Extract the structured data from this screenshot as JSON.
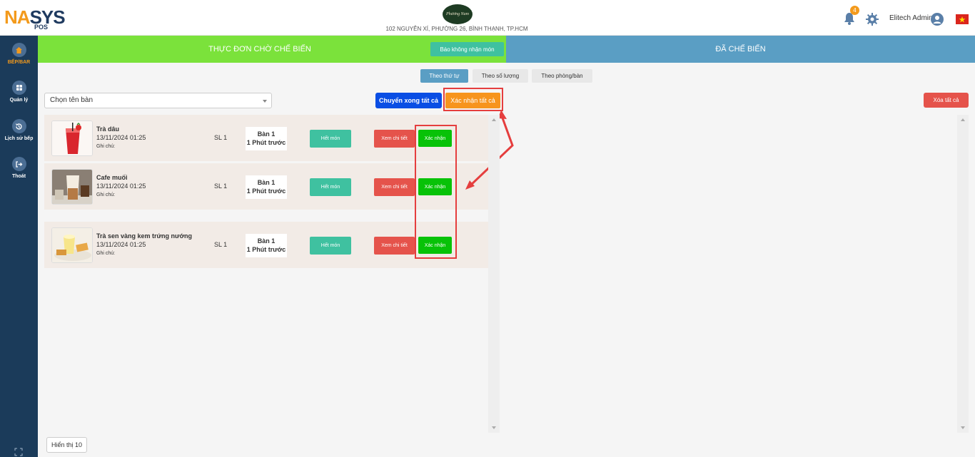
{
  "header": {
    "logo_na": "NA",
    "logo_sys": "SYS",
    "logo_pos": "POS",
    "store_logo_text": "Phương Nam",
    "store_address": "102 NGUYỄN XÍ, PHƯỜNG 26, BÌNH THẠNH, TP.HCM",
    "notification_count": "4",
    "user_name": "Elitech Admin"
  },
  "sidebar": {
    "items": [
      {
        "label": "BẾP/BAR",
        "icon": "home-icon"
      },
      {
        "label": "Quản lý",
        "icon": "grid-icon"
      },
      {
        "label": "Lịch sử bếp",
        "icon": "history-icon"
      },
      {
        "label": "Thoát",
        "icon": "logout-icon"
      }
    ]
  },
  "left_pane": {
    "title": "THỰC ĐƠN CHỜ CHẾ BIẾN",
    "report_button": "Báo không nhận món"
  },
  "right_pane": {
    "title": "ĐÃ CHẾ BIẾN",
    "clear_all_button": "Xóa tất cả"
  },
  "tabs": [
    {
      "label": "Theo thứ tự",
      "active": true
    },
    {
      "label": "Theo số lượng",
      "active": false
    },
    {
      "label": "Theo phòng/bàn",
      "active": false
    }
  ],
  "toolbar": {
    "table_select_placeholder": "Chọn tên bàn",
    "finish_all_button": "Chuyển xong tất cả",
    "confirm_all_button": "Xác nhận tất cả"
  },
  "orders": [
    {
      "name": "Trà dâu",
      "time": "13/11/2024 01:25",
      "note": "Ghi chú:",
      "qty": "SL 1",
      "table": "Bàn 1",
      "elapsed": "1 Phút trước",
      "out_label": "Hết món",
      "detail_label": "Xem chi tiết",
      "confirm_label": "Xác nhận"
    },
    {
      "name": "Cafe muối",
      "time": "13/11/2024 01:25",
      "note": "Ghi chú:",
      "qty": "SL 1",
      "table": "Bàn 1",
      "elapsed": "1 Phút trước",
      "out_label": "Hết món",
      "detail_label": "Xem chi tiết",
      "confirm_label": "Xác nhận"
    },
    {
      "name": "Trà sen vàng kem trứng nướng",
      "time": "13/11/2024 01:25",
      "note": "Ghi chú:",
      "qty": "SL 1",
      "table": "Bàn 1",
      "elapsed": "1 Phút trước",
      "out_label": "Hết món",
      "detail_label": "Xem chi tiết",
      "confirm_label": "Xác nhận"
    }
  ],
  "footer": {
    "show_button": "Hiển thị 10"
  },
  "colors": {
    "accent_green": "#7be23b",
    "accent_blue": "#5a9ec4",
    "sidebar_bg": "#1b3b5a",
    "highlight_red": "#e53e3e"
  }
}
